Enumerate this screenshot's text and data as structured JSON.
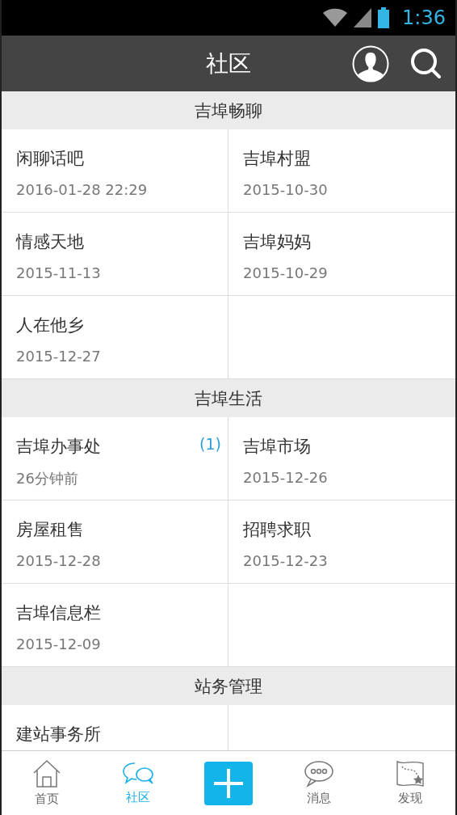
{
  "status_bar": {
    "time": "1:36"
  },
  "header": {
    "title": "社区"
  },
  "sections": [
    {
      "title": "吉埠畅聊",
      "items": [
        {
          "name": "闲聊话吧",
          "date": "2016-01-28 22:29"
        },
        {
          "name": "吉埠村盟",
          "date": "2015-10-30"
        },
        {
          "name": "情感天地",
          "date": "2015-11-13"
        },
        {
          "name": "吉埠妈妈",
          "date": "2015-10-29"
        },
        {
          "name": "人在他乡",
          "date": "2015-12-27"
        }
      ]
    },
    {
      "title": "吉埠生活",
      "items": [
        {
          "name": "吉埠办事处",
          "date": "26分钟前",
          "badge": "(1)"
        },
        {
          "name": "吉埠市场",
          "date": "2015-12-26"
        },
        {
          "name": "房屋租售",
          "date": "2015-12-28"
        },
        {
          "name": "招聘求职",
          "date": "2015-12-23"
        },
        {
          "name": "吉埠信息栏",
          "date": "2015-12-09"
        }
      ]
    },
    {
      "title": "站务管理",
      "items": [
        {
          "name": "建站事务所"
        }
      ]
    }
  ],
  "tab_bar": [
    {
      "kind": "home",
      "label": "首页",
      "selected": false
    },
    {
      "kind": "community",
      "label": "社区",
      "selected": true
    },
    {
      "kind": "add"
    },
    {
      "kind": "messages",
      "label": "消息",
      "selected": false
    },
    {
      "kind": "discover",
      "label": "发现",
      "selected": false
    }
  ]
}
